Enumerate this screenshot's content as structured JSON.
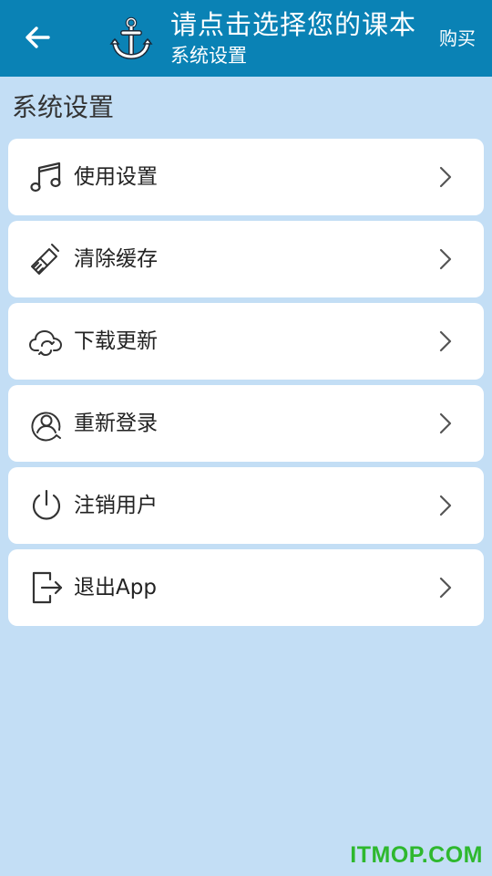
{
  "header": {
    "back_icon": "arrow-left-icon",
    "logo_icon": "anchor-icon",
    "title": "请点击选择您的课本",
    "subtitle": "系统设置",
    "buy_label": "购买",
    "background_color": "#0a82b5"
  },
  "section": {
    "title": "系统设置"
  },
  "menu": {
    "items": [
      {
        "label": "使用设置",
        "icon": "music-note-icon"
      },
      {
        "label": "清除缓存",
        "icon": "broom-icon"
      },
      {
        "label": "下载更新",
        "icon": "cloud-sync-icon"
      },
      {
        "label": "重新登录",
        "icon": "user-circle-icon"
      },
      {
        "label": "注销用户",
        "icon": "power-icon"
      },
      {
        "label": "退出App",
        "icon": "exit-icon"
      }
    ]
  },
  "watermark": {
    "text": "ITMOP.COM",
    "color": "#2eb82e"
  },
  "page_background": "#c3def5"
}
